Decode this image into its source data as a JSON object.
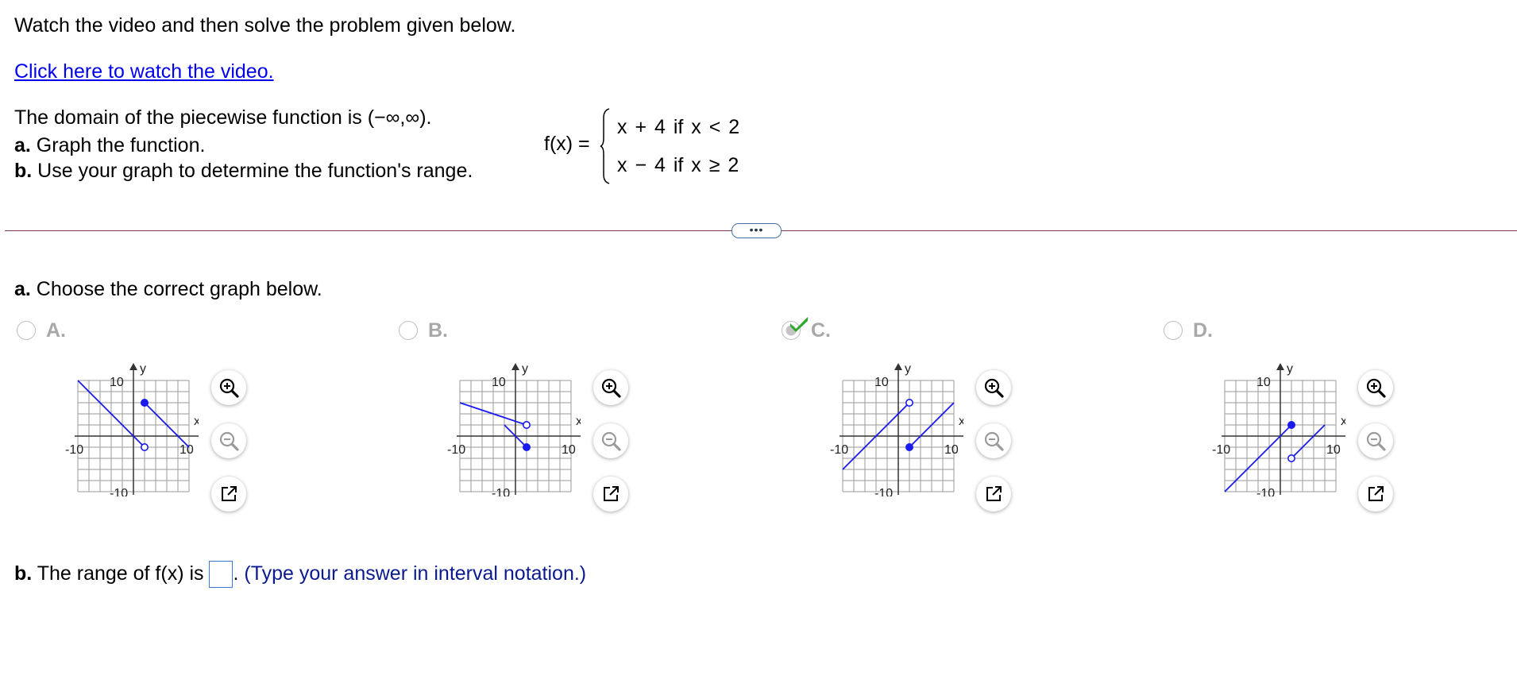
{
  "intro": "Watch the video and then solve the problem given below.",
  "video_link": "Click here to watch the video.",
  "problem": {
    "line1": "The domain of the piecewise function is (−∞,∞).",
    "line2_label": "a.",
    "line2_text": " Graph the function.",
    "line3_label": "b.",
    "line3_text": " Use your graph to determine the function's range."
  },
  "function": {
    "lhs": "f(x) =",
    "piece1": "x + 4  if  x < 2",
    "piece2": "x − 4  if  x ≥ 2"
  },
  "expand_button": "•••",
  "part_a": {
    "label": "a.",
    "text": " Choose the correct graph below."
  },
  "options": [
    {
      "letter": "A.",
      "selected": false,
      "graph": {
        "segments": [
          {
            "from": [
              -10,
              10
            ],
            "to": [
              2,
              -2
            ],
            "to_endpoint": "open"
          },
          {
            "from": [
              2,
              6
            ],
            "to": [
              10,
              -2
            ],
            "from_endpoint": "closed"
          }
        ]
      }
    },
    {
      "letter": "B.",
      "selected": false,
      "graph": {
        "segments": [
          {
            "from": [
              -10,
              6
            ],
            "to": [
              2,
              2
            ],
            "to_endpoint": "open"
          },
          {
            "from": [
              2,
              -2
            ],
            "to": [
              -2,
              2
            ],
            "from_endpoint": "closed"
          }
        ]
      }
    },
    {
      "letter": "C.",
      "selected": true,
      "graph": {
        "segments": [
          {
            "from": [
              -10,
              -6
            ],
            "to": [
              2,
              6
            ],
            "to_endpoint": "open"
          },
          {
            "from": [
              2,
              -2
            ],
            "to": [
              10,
              6
            ],
            "from_endpoint": "closed"
          }
        ]
      }
    },
    {
      "letter": "D.",
      "selected": false,
      "graph": {
        "segments": [
          {
            "from": [
              -10,
              -10
            ],
            "to": [
              2,
              2
            ],
            "to_endpoint": "closed"
          },
          {
            "from": [
              2,
              -4
            ],
            "to": [
              8,
              2
            ],
            "from_endpoint": "open"
          }
        ]
      }
    }
  ],
  "graph_axes": {
    "x_label": "x",
    "y_label": "y",
    "x_min_label": "-10",
    "x_max_label": "10",
    "y_max_label": "10",
    "y_min_label": "-10",
    "range": [
      -10,
      10
    ]
  },
  "colors": {
    "accent": "#0000ee",
    "line": "#1a1aee",
    "check": "#2fa82f"
  },
  "icons": [
    "zoom-in-icon",
    "zoom-out-icon",
    "open-new-window-icon"
  ],
  "part_b": {
    "label": "b.",
    "text": " The range of f(x) is ",
    "after": ". ",
    "hint": "(Type your answer in interval notation.)",
    "answer_value": ""
  }
}
